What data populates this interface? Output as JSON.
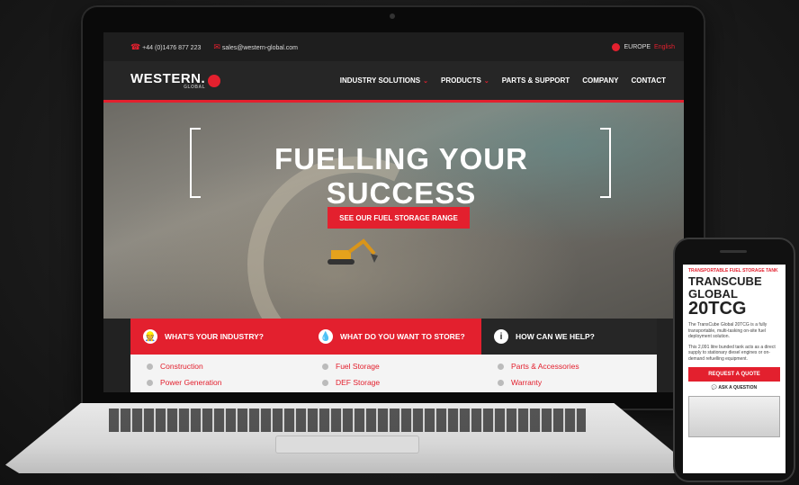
{
  "topbar": {
    "phone": "+44 (0)1476 877 223",
    "email": "sales@western-global.com",
    "region": "EUROPE",
    "language": "English"
  },
  "brand": {
    "logo": "WESTERN.",
    "sub": "GLOBAL"
  },
  "nav": [
    {
      "label": "INDUSTRY SOLUTIONS",
      "dropdown": true
    },
    {
      "label": "PRODUCTS",
      "dropdown": true
    },
    {
      "label": "PARTS & SUPPORT",
      "dropdown": false
    },
    {
      "label": "COMPANY",
      "dropdown": false
    },
    {
      "label": "CONTACT",
      "dropdown": false
    }
  ],
  "hero": {
    "title": "FUELLING YOUR SUCCESS",
    "cta": "SEE OUR FUEL STORAGE RANGE"
  },
  "panels": [
    {
      "label": "WHAT'S YOUR INDUSTRY?",
      "icon": "worker-icon",
      "items": [
        "Construction",
        "Power Generation"
      ]
    },
    {
      "label": "WHAT DO YOU WANT TO STORE?",
      "icon": "drop-icon",
      "items": [
        "Fuel Storage",
        "DEF Storage"
      ]
    },
    {
      "label": "HOW CAN WE HELP?",
      "icon": "info-icon",
      "items": [
        "Parts & Accessories",
        "Warranty"
      ]
    }
  ],
  "mobile": {
    "kicker": "TRANSPORTABLE FUEL STORAGE TANK",
    "name": "TRANSCUBE GLOBAL",
    "model": "20TCG",
    "text1": "The TransCube Global 20TCG is a fully transportable, multi-tasking on-site fuel deployment solution.",
    "text2": "This 2,091 litre bunded tank acts as a direct supply to stationary diesel engines or on-demand refuelling equipment.",
    "quote_button": "REQUEST A QUOTE",
    "ask": "ASK A QUESTION"
  },
  "colors": {
    "accent": "#e3202e",
    "dark": "#262626"
  }
}
